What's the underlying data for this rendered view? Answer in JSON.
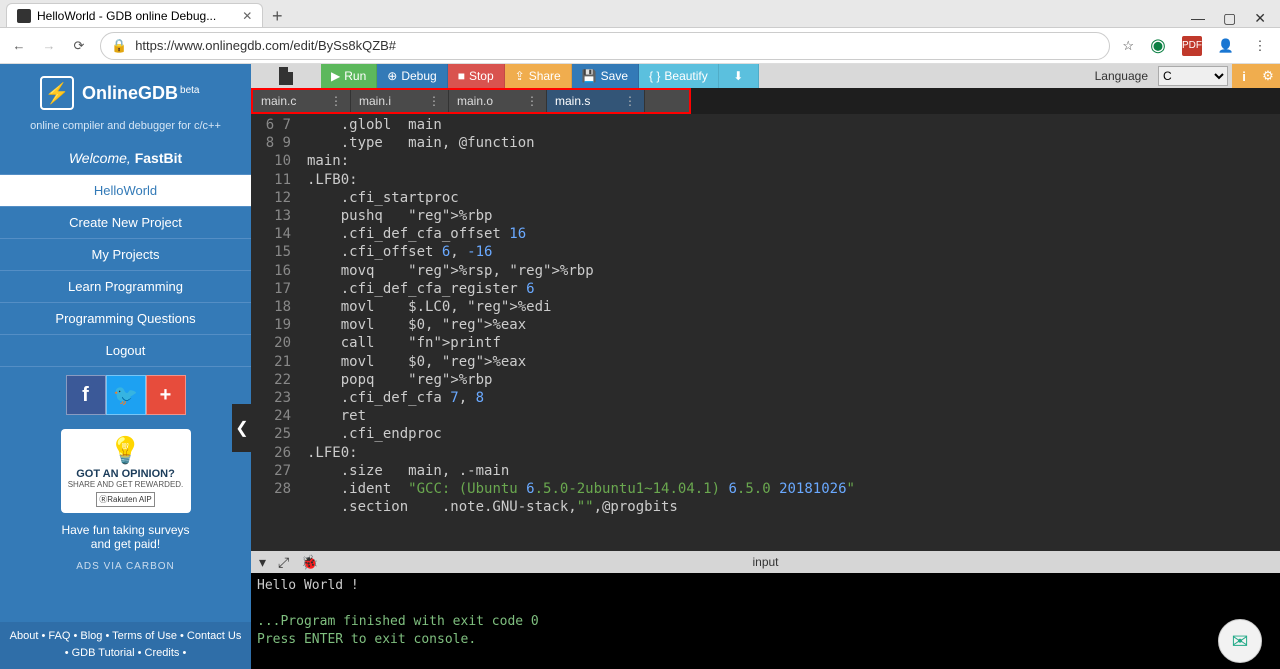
{
  "browser": {
    "tab_title": "HelloWorld - GDB online Debug...",
    "url": "https://www.onlinegdb.com/edit/BySs8kQZB#"
  },
  "sidebar": {
    "logo_text": "OnlineGDB",
    "logo_sup": "beta",
    "tagline": "online compiler and debugger for c/c++",
    "welcome_prefix": "Welcome, ",
    "welcome_user": "FastBit",
    "current_file": "HelloWorld",
    "items": [
      "Create New Project",
      "My Projects",
      "Learn Programming",
      "Programming Questions",
      "Logout"
    ],
    "ad": {
      "opinion": "GOT AN OPINION?",
      "small": "SHARE AND GET REWARDED.",
      "rak": "ⓇRakuten AIP"
    },
    "survey1": "Have fun taking surveys",
    "survey2": "and get paid!",
    "ads_via": "ADS VIA CARBON",
    "footer": [
      "About",
      "FAQ",
      "Blog",
      "Terms of Use",
      "Contact Us",
      "GDB Tutorial",
      "Credits"
    ]
  },
  "toolbar": {
    "run": "Run",
    "debug": "Debug",
    "stop": "Stop",
    "share": "Share",
    "save": "Save",
    "beautify": "Beautify",
    "lang_label": "Language",
    "lang_value": "C"
  },
  "file_tabs": [
    {
      "name": "main.c",
      "active": false
    },
    {
      "name": "main.i",
      "active": false
    },
    {
      "name": "main.o",
      "active": false
    },
    {
      "name": "main.s",
      "active": true
    }
  ],
  "code": {
    "first_line": 6,
    "lines": [
      "    .globl  main",
      "    .type   main, @function",
      "main:",
      ".LFB0:",
      "    .cfi_startproc",
      "    pushq   %rbp",
      "    .cfi_def_cfa_offset 16",
      "    .cfi_offset 6, -16",
      "    movq    %rsp, %rbp",
      "    .cfi_def_cfa_register 6",
      "    movl    $.LC0, %edi",
      "    movl    $0, %eax",
      "    call    printf",
      "    movl    $0, %eax",
      "    popq    %rbp",
      "    .cfi_def_cfa 7, 8",
      "    ret",
      "    .cfi_endproc",
      ".LFE0:",
      "    .size   main, .-main",
      "    .ident  \"GCC: (Ubuntu 6.5.0-2ubuntu1~14.04.1) 6.5.0 20181026\"",
      "    .section    .note.GNU-stack,\"\",@progbits",
      ""
    ]
  },
  "io": {
    "label": "input"
  },
  "console": {
    "line1": "Hello World !",
    "line2": "",
    "line3": "...Program finished with exit code 0",
    "line4": "Press ENTER to exit console."
  }
}
